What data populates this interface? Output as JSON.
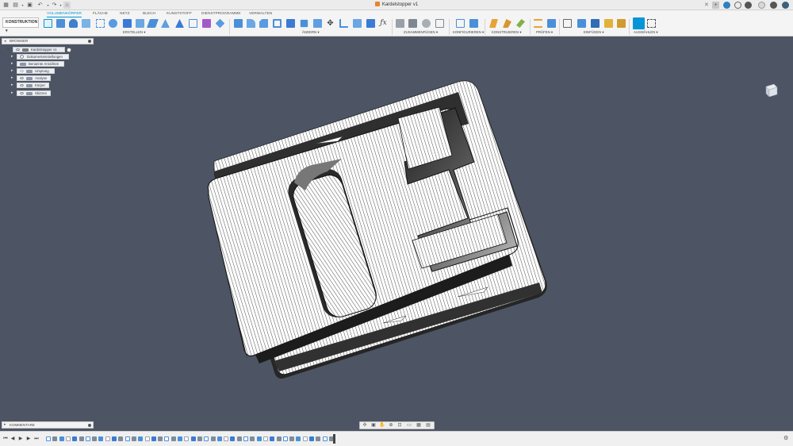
{
  "title_bar": {
    "document_title": "Kardelstopper v1",
    "icons": [
      "grid-menu-icon",
      "file-icon",
      "save-icon",
      "undo-icon",
      "redo-icon",
      "home-icon",
      "new-tab-icon",
      "extensions-icon",
      "clock-icon",
      "notifications-icon",
      "help-icon",
      "user-avatar-icon"
    ]
  },
  "toolbar": {
    "workspace": "KONSTRUKTION",
    "tabs": [
      "VOLUMENKÖRPER",
      "FLÄCHE",
      "NETZ",
      "BLECH",
      "KUNSTSTOFF",
      "DIENSTPROGRAMME",
      "VERWALTEN"
    ],
    "active_tab": "VOLUMENKÖRPER",
    "groups": [
      "ERSTELLEN",
      "ÄNDERN",
      "ZUSAMMENFÜGEN",
      "KONFIGURIEREN",
      "KONSTRUIEREN",
      "PRÜFEN",
      "EINFÜGEN",
      "AUSWÄHLEN"
    ],
    "accent": "#0696d7"
  },
  "browser": {
    "header": "BROWSER",
    "root": "Kardelstopper v1",
    "items": [
      "Dokumenteinstellungen",
      "Benannte Ansichten",
      "Ursprung",
      "Analyse",
      "Körper",
      "Skizzen"
    ]
  },
  "comments": {
    "header": "KOMMENTARE"
  },
  "navbar": {
    "icons": [
      "orbit-icon",
      "look-at-icon",
      "pan-icon",
      "zoom-icon",
      "fit-icon",
      "display-settings-icon",
      "grid-icon",
      "viewports-icon"
    ]
  },
  "timeline": {
    "controls": [
      "go-to-start-icon",
      "step-back-icon",
      "play-icon",
      "step-forward-icon",
      "go-to-end-icon"
    ]
  },
  "colors": {
    "viewport_background": "#4d5564",
    "part_face": "#ffffff",
    "hatch": "#3a3a3a",
    "pocket_shadow": "#2b2b2b"
  }
}
